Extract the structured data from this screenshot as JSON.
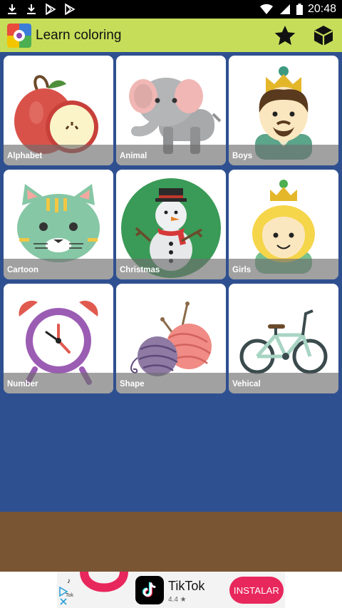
{
  "status_bar": {
    "time": "20:48",
    "left_icons": [
      "download-icon",
      "download-icon",
      "play-store-icon",
      "play-store-icon"
    ],
    "right_icons": [
      "wifi-icon",
      "signal-icon",
      "battery-icon"
    ]
  },
  "app_bar": {
    "title": "Learn coloring",
    "actions": [
      "star-icon",
      "cube-icon"
    ]
  },
  "categories": [
    {
      "label": "Alphabet",
      "icon": "apple-icon"
    },
    {
      "label": "Animal",
      "icon": "elephant-icon"
    },
    {
      "label": "Boys",
      "icon": "prince-icon"
    },
    {
      "label": "Cartoon",
      "icon": "cat-icon"
    },
    {
      "label": "Christmas",
      "icon": "snowman-icon"
    },
    {
      "label": "Girls",
      "icon": "princess-icon"
    },
    {
      "label": "Number",
      "icon": "alarm-clock-icon"
    },
    {
      "label": "Shape",
      "icon": "yarn-balls-icon"
    },
    {
      "label": "Vehical",
      "icon": "bicycle-icon"
    }
  ],
  "ad": {
    "app_name": "TikTok",
    "rating": "4.4 ★",
    "button": "INSTALAR",
    "mini_label": "Tok",
    "colors": {
      "button": "#e8275c",
      "icon_bg": "#010101"
    }
  },
  "colors": {
    "app_bar": "#c6dd5a",
    "grid_background": "#2f5090",
    "ground": "#7a5533"
  }
}
